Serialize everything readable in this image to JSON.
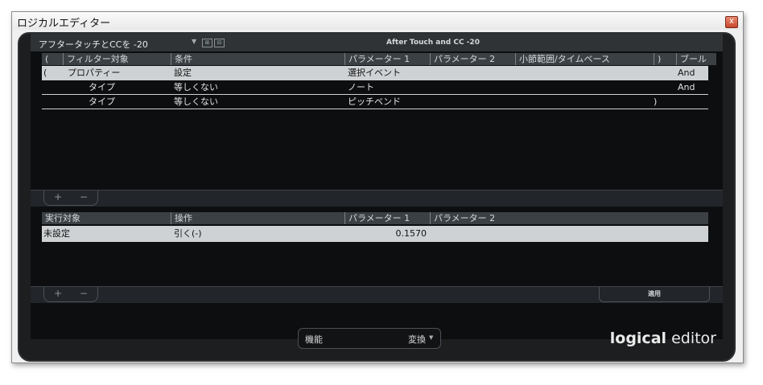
{
  "window": {
    "title": "ロジカルエディター",
    "close": "x"
  },
  "preset": {
    "name": "アフタータッチとCCを -20",
    "title": "After Touch and CC -20"
  },
  "filter": {
    "headers": [
      "(",
      "フィルター対象",
      "条件",
      "パラメーター 1",
      "パラメーター 2",
      "小節範囲/タイムベース",
      ")",
      "ブール"
    ],
    "rows": [
      {
        "open": "(",
        "target": "プロパティー",
        "condition": "設定",
        "param1": "選択イベント",
        "param2": "",
        "range": "",
        "close": "",
        "bool": "And"
      },
      {
        "open": "",
        "target": "タイプ",
        "condition": "等しくない",
        "param1": "ノート",
        "param2": "",
        "range": "",
        "close": "",
        "bool": "And"
      },
      {
        "open": "",
        "target": "タイプ",
        "condition": "等しくない",
        "param1": "ピッチベンド",
        "param2": "",
        "range": "",
        "close": ")",
        "bool": ""
      }
    ]
  },
  "action": {
    "headers": [
      "実行対象",
      "操作",
      "パラメーター 1",
      "パラメーター 2"
    ],
    "rows": [
      {
        "target": "未設定",
        "operation": "引く(-)",
        "param1": "0.1570",
        "param2": ""
      }
    ]
  },
  "buttons": {
    "plus": "+",
    "minus": "−",
    "apply": "適用"
  },
  "function": {
    "label": "機能",
    "value": "変換"
  },
  "logo": {
    "bold": "logical",
    "light": " editor"
  }
}
